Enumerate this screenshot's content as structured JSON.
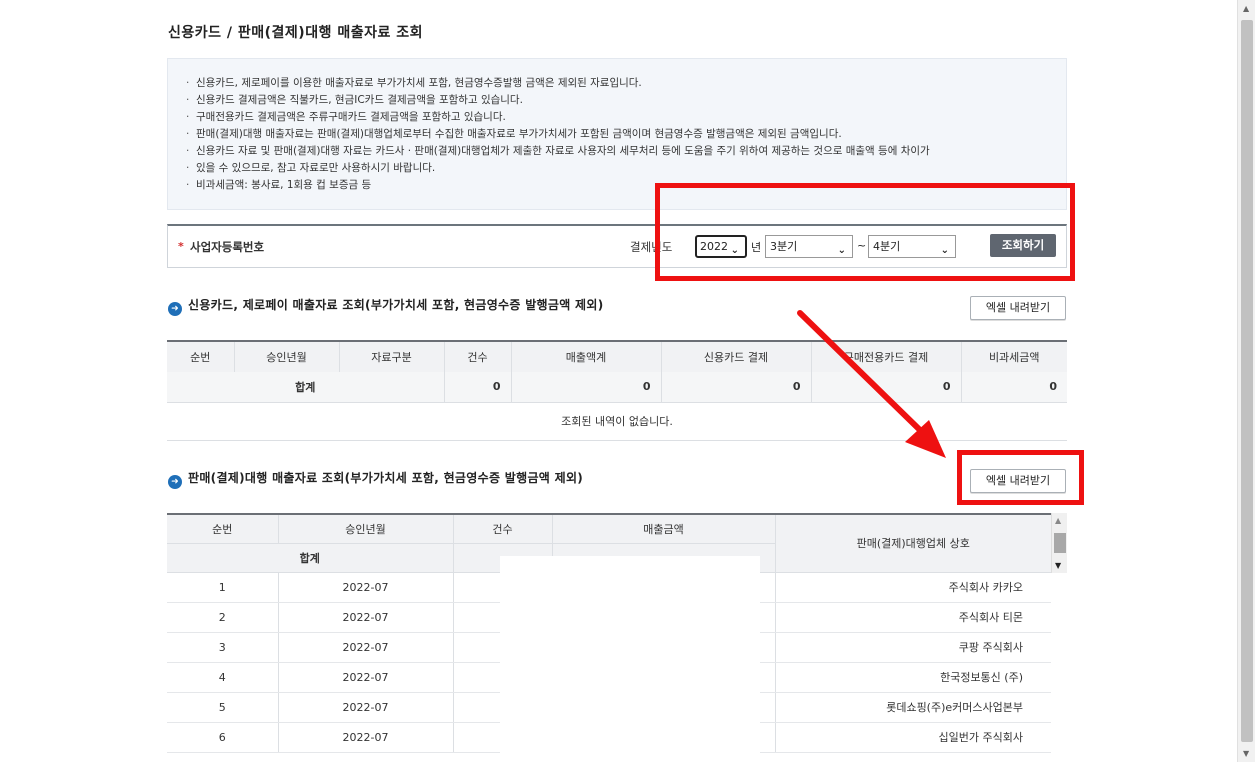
{
  "page": {
    "title": "신용카드 / 판매(결제)대행 매출자료 조회"
  },
  "notice": {
    "items": [
      "신용카드, 제로페이를 이용한 매출자료로 부가가치세 포함, 현금영수증발행 금액은 제외된 자료입니다.",
      "신용카드 결제금액은 직불카드, 현금IC카드 결제금액을 포함하고 있습니다.",
      "구매전용카드 결제금액은 주류구매카드 결제금액을 포함하고 있습니다.",
      "판매(결제)대행 매출자료는 판매(결제)대행업체로부터 수집한 매출자료로 부가가치세가 포함된 금액이며 현금영수증 발행금액은 제외된 금액입니다.",
      "신용카드 자료 및 판매(결제)대행 자료는 카드사 · 판매(결제)대행업체가 제출한 자료로 사용자의 세무처리 등에 도움을 주기 위하여 제공하는 것으로 매출액 등에 차이가",
      "있을 수 있으므로, 참고 자료로만 사용하시기 바랍니다.",
      "비과세금액: 봉사료, 1회용 컵 보증금 등"
    ]
  },
  "search": {
    "required_mark": "*",
    "biz_label": "사업자등록번호",
    "period_label": "결제년도",
    "year": "2022",
    "year_unit": "년",
    "quarter_from": "3분기",
    "tilde": "~",
    "quarter_to": "4분기",
    "search_button": "조회하기"
  },
  "card_section": {
    "title": "신용카드, 제로페이 매출자료 조회(부가가치세 포함, 현금영수증 발행금액 제외)",
    "excel_button": "엑셀 내려받기",
    "headers": [
      "순번",
      "승인년월",
      "자료구분",
      "건수",
      "매출액계",
      "신용카드 결제",
      "구매전용카드 결제",
      "비과세금액"
    ],
    "sum_label": "합계",
    "sum_values": [
      "0",
      "0",
      "0",
      "0",
      "0"
    ],
    "empty_message": "조회된 내역이 없습니다."
  },
  "agency_section": {
    "title": "판매(결제)대행 매출자료 조회(부가가치세 포함, 현금영수증 발행금액 제외)",
    "excel_button": "엑셀 내려받기",
    "headers": {
      "seq": "순번",
      "month": "승인년월",
      "count": "건수",
      "amount": "매출금액",
      "company": "판매(결제)대행업체 상호"
    },
    "sum_label": "합계",
    "rows": [
      {
        "seq": "1",
        "month": "2022-07",
        "company": "주식회사 카카오"
      },
      {
        "seq": "2",
        "month": "2022-07",
        "company": "주식회사 티몬"
      },
      {
        "seq": "3",
        "month": "2022-07",
        "company": "쿠팡 주식회사"
      },
      {
        "seq": "4",
        "month": "2022-07",
        "company": "한국정보통신 (주)"
      },
      {
        "seq": "5",
        "month": "2022-07",
        "company": "롯데쇼핑(주)e커머스사업본부"
      },
      {
        "seq": "6",
        "month": "2022-07",
        "company": "십일번가 주식회사"
      }
    ]
  },
  "icons": {
    "section_bullet": "arrow-circle-icon",
    "dropdown": "chevron-down-icon"
  },
  "colors": {
    "highlight": "#ee1111",
    "section_icon": "#1f6fb8",
    "search_button": "#5f6670"
  }
}
